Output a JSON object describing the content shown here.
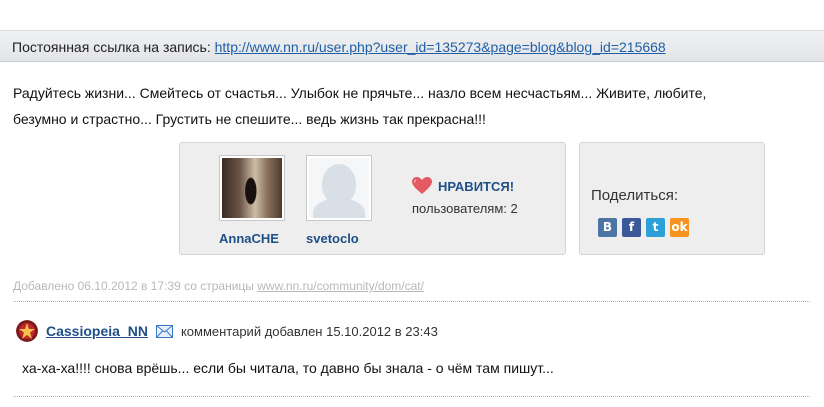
{
  "permalink": {
    "label": "Постоянная ссылка на запись:",
    "url": "http://www.nn.ru/user.php?user_id=135273&page=blog&blog_id=215668"
  },
  "post": {
    "line1": "Радуйтесь жизни... Смейтесь от счастья... Улыбок не прячьте... назло всем несчастьям... Живите, любите,",
    "line2": "безумно и страстно... Грустить не спешите... ведь жизнь так прекрасна!!!"
  },
  "likes": {
    "users": [
      {
        "name": "AnnaCHE"
      },
      {
        "name": "svetoclo"
      }
    ],
    "button_label": "НРАВИТСЯ!",
    "count_text": "пользователям: 2"
  },
  "share": {
    "label": "Поделиться:",
    "icons": [
      "vk-icon",
      "facebook-icon",
      "twitter-icon",
      "odnoklassniki-icon"
    ],
    "icon_glyphs": {
      "vk": "В",
      "fb": "f",
      "tw": "t",
      "ok": "ok"
    }
  },
  "meta": {
    "added_text": "Добавлено 06.10.2012 в 17:39 со страницы",
    "page_link": "www.nn.ru/community/dom/cat/"
  },
  "comment": {
    "username": "Cassiopeia_NN",
    "meta": "комментарий добавлен 15.10.2012 в 23:43",
    "text": "ха-ха-ха!!!! снова врёшь... если бы читала, то давно бы знала - о чём там пишут..."
  },
  "colors": {
    "link": "#1f5fa6",
    "username": "#1f4f86",
    "heart": "#e35a63",
    "meta_gray": "#b8b8b8"
  }
}
